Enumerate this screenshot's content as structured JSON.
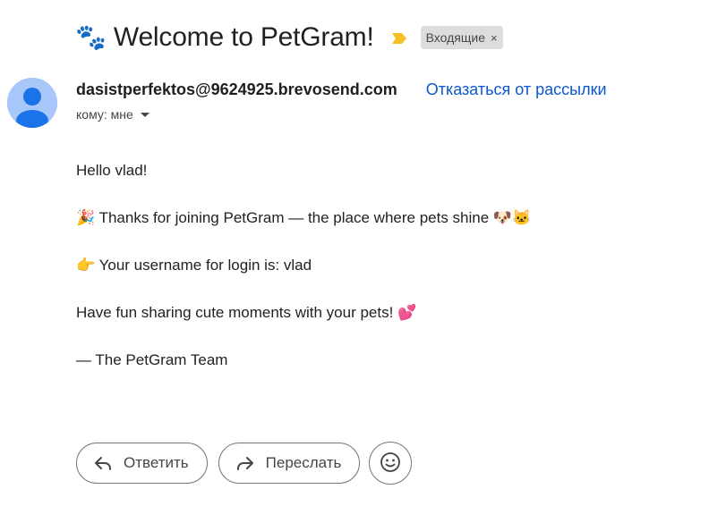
{
  "email": {
    "subject_emoji": "🐾",
    "subject": "Welcome to PetGram!",
    "label": "Входящие",
    "label_close": "×",
    "sender": "dasistperfektos@9624925.brevosend.com",
    "unsubscribe": "Отказаться от рассылки",
    "recipient": "кому: мне",
    "body": {
      "line1": "Hello vlad!",
      "line2": "🎉 Thanks for joining PetGram — the place where pets shine 🐶🐱",
      "line3": "👉 Your username for login is: vlad",
      "line4": "Have fun sharing cute moments with your pets! 💕",
      "line5": "— The PetGram Team"
    }
  },
  "actions": {
    "reply": "Ответить",
    "forward": "Переслать"
  },
  "colors": {
    "accent_link": "#0b57d0",
    "avatar_bg": "#a8c7fa",
    "avatar_fg": "#1a73e8",
    "important_marker": "#f6bf26",
    "chip_bg": "#dddddd"
  }
}
